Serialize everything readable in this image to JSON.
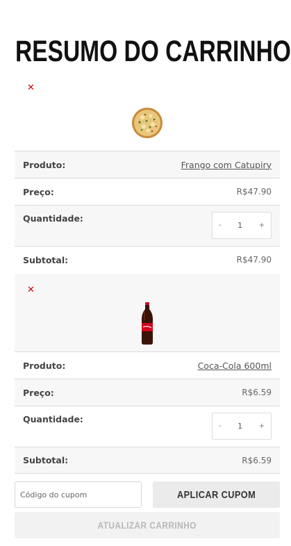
{
  "page": {
    "title": "RESUMO DO CARRINHO"
  },
  "cart": {
    "items": [
      {
        "remove_icon": "close-icon",
        "image": "pizza",
        "product_label": "Produto:",
        "product_name": "Frango com Catupiry",
        "price_label": "Preço:",
        "price": "R$47.90",
        "quantity_label": "Quantidade:",
        "quantity_minus": "-",
        "quantity": "1",
        "quantity_plus": "+",
        "subtotal_label": "Subtotal:",
        "subtotal": "R$47.90"
      },
      {
        "remove_icon": "close-icon",
        "image": "coca-cola-bottle",
        "product_label": "Produto:",
        "product_name": "Coca-Cola 600ml",
        "price_label": "Preço:",
        "price": "R$6.59",
        "quantity_label": "Quantidade:",
        "quantity_minus": "-",
        "quantity": "1",
        "quantity_plus": "+",
        "subtotal_label": "Subtotal:",
        "subtotal": "R$6.59"
      }
    ]
  },
  "coupon": {
    "placeholder": "Código do cupom",
    "apply_label": "APLICAR CUPOM"
  },
  "update_label": "ATUALIZAR CARRINHO",
  "colors": {
    "remove": "#cc0000",
    "text": "#333333",
    "border": "#dcdcdc",
    "button_bg": "#ebebeb"
  }
}
